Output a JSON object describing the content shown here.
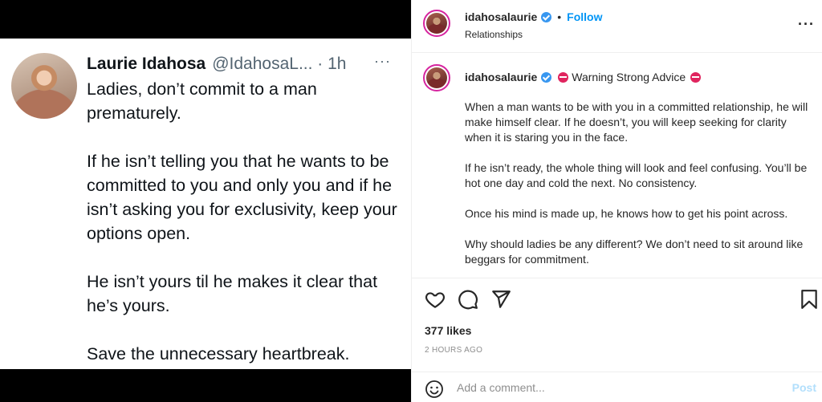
{
  "tweet": {
    "name": "Laurie Idahosa",
    "handle": "@IdahosaL... · 1h",
    "more": "···",
    "paragraphs": [
      "Ladies, don’t commit to a man prematurely.",
      "If he isn’t telling you that he wants to be committed to you and only you and if he isn’t asking you for exclusivity, keep your options open.",
      "He isn’t yours til he makes it clear that he’s yours.",
      "Save the unnecessary heartbreak."
    ]
  },
  "post_header": {
    "username": "idahosalaurie",
    "separator": "•",
    "follow_label": "Follow",
    "subtitle": "Relationships",
    "more": "···"
  },
  "caption": {
    "username": "idahosalaurie",
    "title": "Warning Strong Advice",
    "paragraphs": [
      "When a man wants to be with you in a committed relationship, he will make himself clear. If he doesn’t, you will keep seeking for clarity when it is staring you in the face.",
      "If he isn’t ready, the whole thing will look and feel confusing. You’ll be hot one day and cold the next. No consistency.",
      "Once his mind is made up, he knows how to get his point across.",
      "Why should ladies be any different? We don’t need to sit around like beggars for commitment."
    ]
  },
  "actions": {
    "icons": [
      "heart-icon",
      "comment-icon",
      "share-icon",
      "bookmark-icon"
    ]
  },
  "likes": "377 likes",
  "posted": "2 HOURS AGO",
  "comment": {
    "placeholder": "Add a comment...",
    "post_label": "Post"
  },
  "colors": {
    "follow": "#0095f6",
    "verified": "#3897f0",
    "no_entry": "#e0245e",
    "post_disabled": "#b2dffc"
  }
}
